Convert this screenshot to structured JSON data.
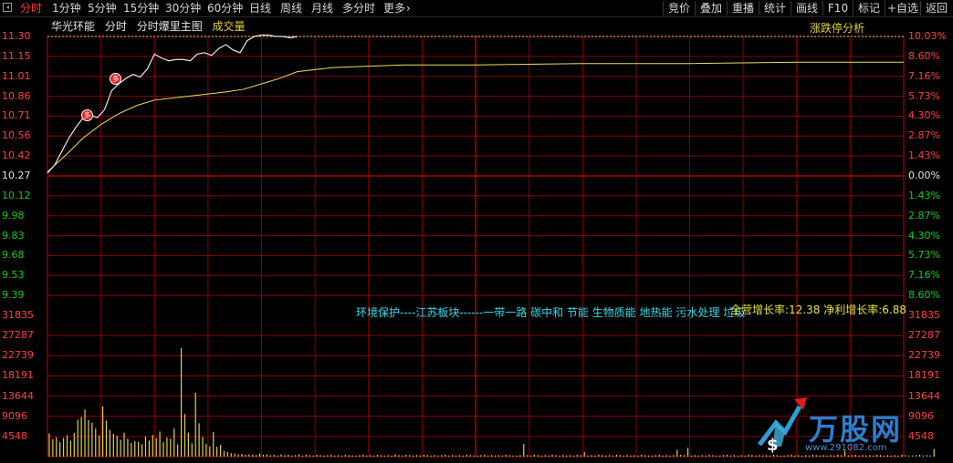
{
  "toolbar": {
    "tabs": [
      "分时",
      "1分钟",
      "5分钟",
      "15分钟",
      "30分钟",
      "60分钟",
      "日线",
      "周线",
      "月线",
      "多分时",
      "更多"
    ],
    "right": [
      "竞价",
      "叠加",
      "重播",
      "统计",
      "画线",
      "F10",
      "标记",
      "+自选",
      "返回"
    ]
  },
  "header": {
    "stock": "华光环能",
    "mode1": "分时",
    "mode2": "分时爆里主图",
    "mode3": "成交量",
    "limit": "涨跌停分析"
  },
  "concepts": {
    "text": "环境保护----江苏板块------一带一路 碳中和 节能 生物质能 地热能 污水处理 垃圾",
    "overlay": "全营增长率:12.38 净利增长率:6.88"
  },
  "marker_label": "多",
  "watermark": {
    "brand": "万股网",
    "url": "www.291082.com"
  },
  "colors": {
    "up": "#ff4040",
    "down": "#19c819",
    "price": "#e8e8e8",
    "avg": "#e8e060",
    "vol": "#e0d050",
    "grid": "#8a0000"
  },
  "chart_data": {
    "type": "line",
    "price_axis": {
      "up": [
        "11.30",
        "11.15",
        "11.01",
        "10.86",
        "10.71",
        "10.56",
        "10.42"
      ],
      "base": "10.27",
      "down": [
        "10.12",
        "9.98",
        "9.83",
        "9.68",
        "9.53",
        "9.39"
      ]
    },
    "pct_axis": {
      "up": [
        "10.03%",
        "8.60%",
        "7.16%",
        "5.73%",
        "4.30%",
        "2.87%",
        "1.43%"
      ],
      "base": "0.00%",
      "down": [
        "1.43%",
        "2.87%",
        "4.30%",
        "5.73%",
        "7.16%",
        "8.60%"
      ]
    },
    "volume_axis": [
      "31835",
      "27287",
      "22739",
      "18191",
      "13644",
      "9096",
      "4548"
    ],
    "price_minutes": [
      0,
      2,
      4,
      6,
      8,
      10,
      12,
      14,
      16,
      18,
      20,
      22,
      24,
      26,
      28,
      30,
      32,
      34,
      36,
      38,
      40,
      42,
      44,
      46,
      48,
      50,
      52,
      54,
      56,
      58,
      60,
      62,
      64,
      66,
      68,
      70
    ],
    "price": [
      10.29,
      10.35,
      10.45,
      10.55,
      10.63,
      10.7,
      10.72,
      10.7,
      10.76,
      10.9,
      10.95,
      10.99,
      11.02,
      11.0,
      11.06,
      11.17,
      11.14,
      11.12,
      11.13,
      11.13,
      11.12,
      11.17,
      11.18,
      11.16,
      11.21,
      11.24,
      11.2,
      11.18,
      11.27,
      11.3,
      11.31,
      11.31,
      11.3,
      11.3,
      11.29,
      11.3
    ],
    "avg_minutes": [
      0,
      5,
      10,
      15,
      20,
      25,
      30,
      40,
      50,
      55,
      60,
      65,
      70,
      80,
      90,
      100,
      120,
      150,
      180,
      210,
      240
    ],
    "avg": [
      10.3,
      10.42,
      10.55,
      10.65,
      10.73,
      10.79,
      10.83,
      10.86,
      10.89,
      10.91,
      10.95,
      10.99,
      11.04,
      11.07,
      11.08,
      11.09,
      11.09,
      11.1,
      11.1,
      11.11,
      11.11
    ],
    "buy_marks": [
      {
        "minute": 11,
        "price": 10.72
      },
      {
        "minute": 19,
        "price": 10.99
      }
    ],
    "volume": [
      6100,
      4600,
      5100,
      3800,
      4900,
      5600,
      4200,
      6200,
      9700,
      10400,
      12400,
      9600,
      8900,
      7400,
      5600,
      13200,
      9500,
      7000,
      6000,
      5500,
      4400,
      6300,
      4700,
      3600,
      4100,
      3900,
      3300,
      5300,
      4200,
      5700,
      4900,
      6600,
      3800,
      5000,
      4700,
      7400,
      3200,
      28500,
      11200,
      6300,
      3500,
      16800,
      8800,
      5200,
      3300,
      2700,
      6500,
      2600,
      3100,
      1500,
      1200,
      900,
      800,
      600,
      700,
      500,
      600,
      500,
      400,
      800,
      500,
      600,
      400,
      500,
      300,
      600,
      400,
      500,
      300,
      400,
      600,
      300,
      500,
      400,
      300,
      500,
      400,
      300,
      400,
      500,
      300,
      400,
      300,
      500,
      400,
      300,
      300,
      400,
      500,
      300,
      400,
      300,
      500,
      400,
      300,
      400,
      300,
      600,
      400,
      300,
      500,
      400,
      300,
      400,
      300,
      500,
      400,
      300,
      400,
      300,
      400,
      500,
      300,
      400,
      300,
      400,
      300,
      500,
      400,
      300,
      300,
      400,
      500,
      300,
      400,
      300,
      400,
      300,
      500,
      400,
      300,
      300,
      400,
      3300,
      400,
      300,
      500,
      400,
      300,
      400,
      300,
      500,
      400,
      300,
      400,
      300,
      400,
      300,
      500,
      400,
      1200,
      300,
      400,
      300,
      500,
      400,
      300,
      400,
      300,
      500,
      400,
      300,
      400,
      300,
      400,
      300,
      500,
      400,
      300,
      300,
      400,
      500,
      300,
      400,
      300,
      400,
      1800,
      500,
      400,
      2300,
      300,
      400,
      300,
      400,
      300,
      500,
      400,
      300,
      300,
      400,
      500,
      300,
      400,
      300,
      400,
      300,
      500,
      400,
      300,
      400,
      300,
      400,
      300,
      500,
      400,
      300,
      300,
      400,
      500,
      300,
      400,
      300,
      400,
      300,
      500,
      400,
      300,
      400,
      300,
      400,
      300,
      500,
      400,
      1600,
      300,
      400,
      500,
      300,
      400,
      300,
      400,
      300,
      500,
      400,
      300,
      400,
      300,
      400,
      300,
      500,
      400,
      300,
      300,
      400,
      500,
      300,
      400,
      300,
      2000
    ]
  }
}
